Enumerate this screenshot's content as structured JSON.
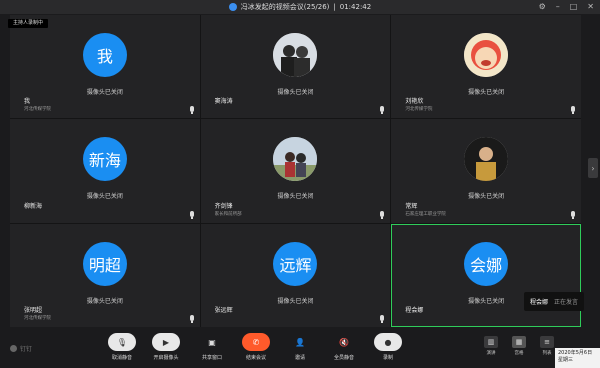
{
  "titlebar": {
    "title": "冯冰发起的视频会议(25/26)",
    "separator": "|",
    "timer": "01:42:42",
    "controls": [
      "⚙",
      "–",
      "□",
      "✕"
    ]
  },
  "recording_badge": "主持人录制中",
  "tiles": [
    {
      "avatar": "我",
      "status": "摄像头已关闭",
      "name": "我",
      "org": "河北传媒学院"
    },
    {
      "avatar": "",
      "status": "摄像头已关闭",
      "name": "窦海涛",
      "org": ""
    },
    {
      "avatar": "",
      "status": "摄像头已关闭",
      "name": "刘艳欣",
      "org": "河北传媒学院"
    },
    {
      "avatar": "新海",
      "status": "摄像头已关闭",
      "name": "柳新海",
      "org": ""
    },
    {
      "avatar": "",
      "status": "摄像头已关闭",
      "name": "齐剑锋",
      "org": "家长和前所部"
    },
    {
      "avatar": "",
      "status": "摄像头已关闭",
      "name": "常辉",
      "org": "石家庄理工职业学院"
    },
    {
      "avatar": "明超",
      "status": "摄像头已关闭",
      "name": "张明超",
      "org": "河北传媒学院"
    },
    {
      "avatar": "远辉",
      "status": "摄像头已关闭",
      "name": "张远辉",
      "org": ""
    },
    {
      "avatar": "会娜",
      "status": "摄像头已关闭",
      "name": "程会娜",
      "org": ""
    }
  ],
  "speaking": {
    "name": "程会娜",
    "state": "正在发言"
  },
  "brand": "钉钉",
  "toolbar": [
    {
      "label": "取消静音",
      "icon": "mic-icon"
    },
    {
      "label": "开启摄像头",
      "icon": "camera-icon"
    },
    {
      "label": "共享窗口",
      "icon": "share-icon"
    },
    {
      "label": "结束会议",
      "icon": "phone-icon"
    },
    {
      "label": "邀请",
      "icon": "invite-icon"
    },
    {
      "label": "全员静音",
      "icon": "mute-all-icon"
    },
    {
      "label": "录制",
      "icon": "record-icon"
    }
  ],
  "views": [
    {
      "label": "演讲"
    },
    {
      "label": "宫格"
    },
    {
      "label": "列表"
    }
  ],
  "datetime": {
    "date": "2020年5月6日",
    "weekday": "星期三"
  },
  "colors": {
    "avatar_blue": "#1a8ef2",
    "end_call_red": "#ff5a2b",
    "active_speaker_border": "#2fcc5a"
  }
}
